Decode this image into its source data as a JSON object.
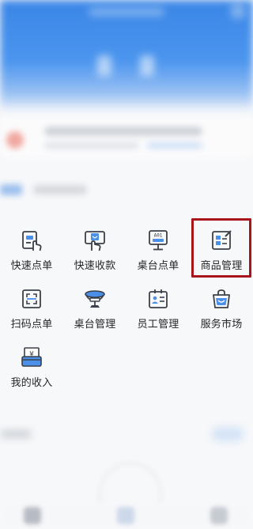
{
  "colors": {
    "accent": "#3a86e6",
    "icon_blue": "#4a8fe8",
    "icon_dark": "#3b4048",
    "highlight": "#a8161b"
  },
  "tiles": [
    {
      "label": "快速点单",
      "icon": "quick-order-icon"
    },
    {
      "label": "快速收款",
      "icon": "quick-payment-icon"
    },
    {
      "label": "桌台点单",
      "icon": "table-order-icon",
      "icon_text": "A01"
    },
    {
      "label": "商品管理",
      "icon": "product-management-icon",
      "highlighted": true
    },
    {
      "label": "扫码点单",
      "icon": "scan-order-icon"
    },
    {
      "label": "桌台管理",
      "icon": "table-management-icon"
    },
    {
      "label": "员工管理",
      "icon": "staff-management-icon"
    },
    {
      "label": "服务市场",
      "icon": "service-market-icon"
    },
    {
      "label": "我的收入",
      "icon": "my-income-icon",
      "icon_text": "¥"
    }
  ]
}
